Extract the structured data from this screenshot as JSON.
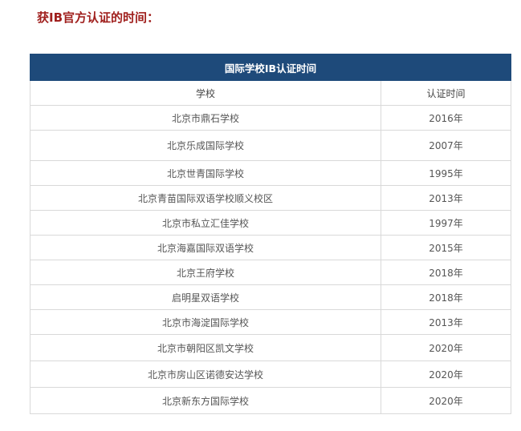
{
  "heading": "获IB官方认证的时间：",
  "table": {
    "title": "国际学校IB认证时间",
    "columns": [
      "学校",
      "认证时间"
    ],
    "rows": [
      [
        "北京市鼎石学校",
        "2016年"
      ],
      [
        "北京乐成国际学校",
        "2007年"
      ],
      [
        "北京世青国际学校",
        "1995年"
      ],
      [
        "北京青苗国际双语学校顺义校区",
        "2013年"
      ],
      [
        "北京市私立汇佳学校",
        "1997年"
      ],
      [
        "北京海嘉国际双语学校",
        "2015年"
      ],
      [
        "北京王府学校",
        "2018年"
      ],
      [
        "启明星双语学校",
        "2018年"
      ],
      [
        "北京市海淀国际学校",
        "2013年"
      ],
      [
        "北京市朝阳区凯文学校",
        "2020年"
      ],
      [
        "北京市房山区诺德安达学校",
        "2020年"
      ],
      [
        "北京新东方国际学校",
        "2020年"
      ]
    ]
  }
}
